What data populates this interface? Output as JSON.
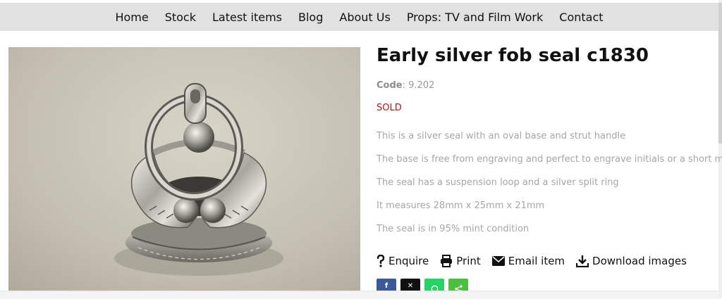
{
  "nav": {
    "items": [
      {
        "label": "Home"
      },
      {
        "label": "Stock"
      },
      {
        "label": "Latest items"
      },
      {
        "label": "Blog"
      },
      {
        "label": "About Us"
      },
      {
        "label": "Props: TV and Film Work"
      },
      {
        "label": "Contact"
      }
    ]
  },
  "product": {
    "title": "Early silver fob seal c1830",
    "code_label": "Code",
    "code_value": ": 9.202",
    "status": "SOLD",
    "description": [
      "This is a silver seal with an oval base and strut handle",
      "The base is free from engraving and perfect to engrave initials or a short message",
      "The seal has a suspension loop and a silver split ring",
      "It measures 28mm x 25mm x 21mm",
      "The seal is in 95% mint condition"
    ],
    "image_icon": "silver-fob-seal-photo"
  },
  "actions": [
    {
      "label": "Enquire",
      "icon": "question-icon"
    },
    {
      "label": "Print",
      "icon": "printer-icon"
    },
    {
      "label": "Email item",
      "icon": "envelope-icon"
    },
    {
      "label": "Download images",
      "icon": "download-icon"
    }
  ],
  "share": [
    {
      "icon": "facebook-icon",
      "color": "#3b5998",
      "glyph": "f"
    },
    {
      "icon": "x-twitter-icon",
      "color": "#111111",
      "glyph": "𝕏"
    },
    {
      "icon": "whatsapp-icon",
      "color": "#25d366",
      "glyph": "◔"
    },
    {
      "icon": "share-icon",
      "color": "#4cbf3f",
      "glyph": "<"
    }
  ],
  "colors": {
    "nav_bg": "#e1e1e1",
    "sold": "#b01818",
    "muted_text": "#a6a6a6"
  }
}
